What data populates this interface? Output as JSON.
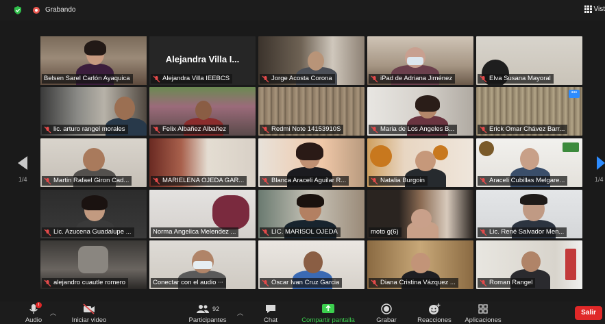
{
  "topbar": {
    "recording_label": "Grabando",
    "view_label": "Vist"
  },
  "navigation": {
    "page_left": "1/4",
    "page_right": "1/4"
  },
  "tiles": [
    {
      "name": "Belsen Sarel Carlón Ayaquica",
      "muted": false,
      "active": true
    },
    {
      "name": "Alejandra Villa IEEBCS",
      "display": "Alejandra Villa I...",
      "muted": true
    },
    {
      "name": "Jorge Acosta Corona",
      "muted": true
    },
    {
      "name": "iPad de Adriana Jiménez",
      "muted": true
    },
    {
      "name": "Elva Susana Mayoral",
      "muted": true
    },
    {
      "name": "lic. arturo rangel morales",
      "muted": true
    },
    {
      "name": "Felix Albañez Albañez",
      "muted": true
    },
    {
      "name": "Redmi Note 14153910S",
      "muted": true
    },
    {
      "name": "Maria de Los Angeles B...",
      "muted": true
    },
    {
      "name": "Erick Omar Chávez Barr...",
      "muted": true
    },
    {
      "name": "Martin Rafael Giron Cad...",
      "muted": true
    },
    {
      "name": "MARIELENA OJEDA GAR...",
      "muted": true
    },
    {
      "name": "Blanca Araceli Aguilar R...",
      "muted": true
    },
    {
      "name": "Natalia Burgoin",
      "muted": true
    },
    {
      "name": "Araceli Cubillas Melgare...",
      "muted": true
    },
    {
      "name": "Lic. Azucena Guadalupe ...",
      "muted": true
    },
    {
      "name": "Norma Angelica Melendez ...",
      "muted": false
    },
    {
      "name": "LIC. MARISOL OJEDA",
      "muted": true
    },
    {
      "name": "moto g(6)",
      "muted": false
    },
    {
      "name": "Lic. René Salvador Men...",
      "muted": true
    },
    {
      "name": "alejandro cuautle romero",
      "muted": true
    },
    {
      "name": "Conectar con el audio",
      "muted": false
    },
    {
      "name": "Oscar Ivan Cruz Garcia",
      "muted": true
    },
    {
      "name": "Diana Cristina Vázquez ...",
      "muted": true
    },
    {
      "name": "Roman Rangel",
      "muted": true
    }
  ],
  "toolbar": {
    "audio": "Audio",
    "video": "Iniciar video",
    "participants": "Participantes",
    "participants_count": "92",
    "chat": "Chat",
    "share": "Compartir pantalla",
    "record": "Grabar",
    "reactions": "Reacciones",
    "apps": "Aplicaciones",
    "leave": "Salir",
    "audio_badge": "!"
  },
  "colors": {
    "active_outline": "#cfe06d",
    "share_green": "#3ccf4e",
    "leave_red": "#e02828",
    "accent_blue": "#2d8cff"
  }
}
